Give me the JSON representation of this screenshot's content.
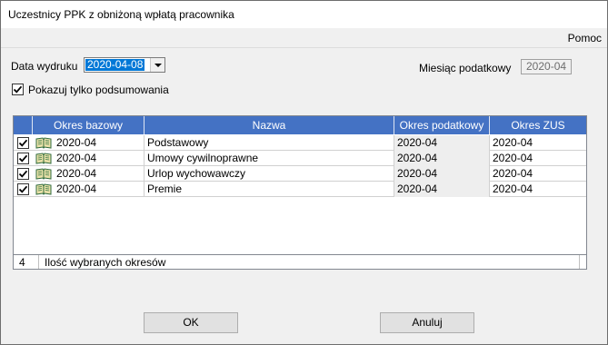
{
  "window": {
    "title": "Uczestnicy PPK z obniżoną wpłatą pracownika"
  },
  "menu": {
    "help_label": "Pomoc"
  },
  "form": {
    "print_date_label": "Data wydruku",
    "print_date_value": "2020-04-08",
    "tax_month_label": "Miesiąc podatkowy",
    "tax_month_value": "2020-04",
    "summary_only_label": "Pokazuj tylko podsumowania",
    "summary_only_checked": true
  },
  "grid": {
    "columns": [
      "Okres bazowy",
      "Nazwa",
      "Okres podatkowy",
      "Okres ZUS"
    ],
    "rows": [
      {
        "checked": true,
        "icon": "book-icon",
        "base_period": "2020-04",
        "name": "Podstawowy",
        "tax_period": "2020-04",
        "zus_period": "2020-04"
      },
      {
        "checked": true,
        "icon": "book-icon",
        "base_period": "2020-04",
        "name": "Umowy cywilnoprawne",
        "tax_period": "2020-04",
        "zus_period": "2020-04"
      },
      {
        "checked": true,
        "icon": "book-icon",
        "base_period": "2020-04",
        "name": "Urlop wychowawczy",
        "tax_period": "2020-04",
        "zus_period": "2020-04"
      },
      {
        "checked": true,
        "icon": "book-icon",
        "base_period": "2020-04",
        "name": "Premie",
        "tax_period": "2020-04",
        "zus_period": "2020-04"
      }
    ],
    "header_color": "#4472c4"
  },
  "footer": {
    "count": "4",
    "count_label": "Ilość wybranych okresów"
  },
  "buttons": {
    "ok_label": "OK",
    "cancel_label": "Anuluj"
  },
  "colors": {
    "selection": "#0078d7",
    "header": "#4472c4"
  }
}
